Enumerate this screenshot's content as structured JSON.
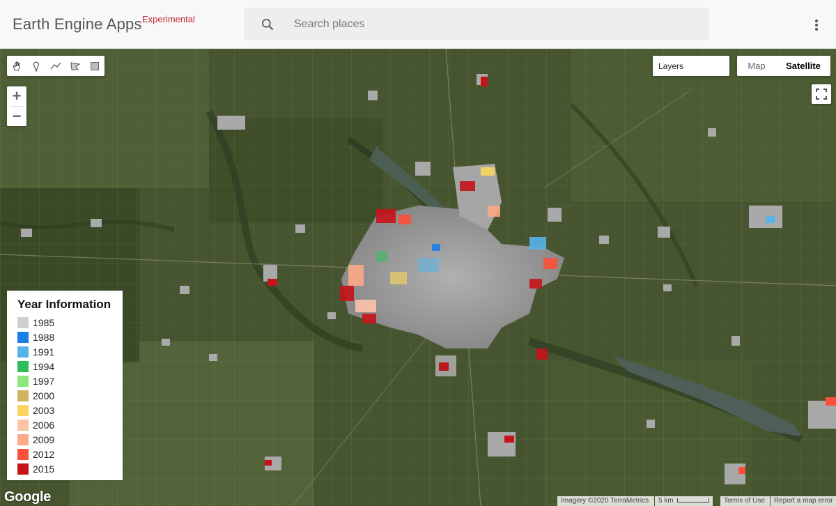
{
  "header": {
    "brand": "Earth Engine Apps",
    "brand_tag": "Experimental",
    "search_placeholder": "Search places"
  },
  "icons": {
    "search": "search-icon",
    "more": "more-vert-icon",
    "pan": "hand-icon",
    "point": "marker-icon",
    "line": "line-icon",
    "polygon": "polygon-icon",
    "rectangle": "rectangle-icon",
    "fullscreen": "fullscreen-icon"
  },
  "map": {
    "zoom_in": "+",
    "zoom_out": "−",
    "layers_label": "Layers",
    "maptype_map": "Map",
    "maptype_satellite": "Satellite",
    "maptype_selected": "Satellite"
  },
  "legend": {
    "title": "Year Information",
    "items": [
      {
        "label": "1985",
        "color": "#d0d0d0"
      },
      {
        "label": "1988",
        "color": "#1a7ee8"
      },
      {
        "label": "1991",
        "color": "#56b4e9"
      },
      {
        "label": "1994",
        "color": "#2ebe5c"
      },
      {
        "label": "1997",
        "color": "#8ce87a"
      },
      {
        "label": "2000",
        "color": "#cdb362"
      },
      {
        "label": "2003",
        "color": "#fad660"
      },
      {
        "label": "2006",
        "color": "#fcc3a9"
      },
      {
        "label": "2009",
        "color": "#fba987"
      },
      {
        "label": "2012",
        "color": "#fb5138"
      },
      {
        "label": "2015",
        "color": "#c5131a"
      }
    ]
  },
  "footer": {
    "google": "Google",
    "imagery": "Imagery ©2020 TerraMetrics",
    "scale": "5 km",
    "terms": "Terms of Use",
    "report": "Report a map error"
  }
}
